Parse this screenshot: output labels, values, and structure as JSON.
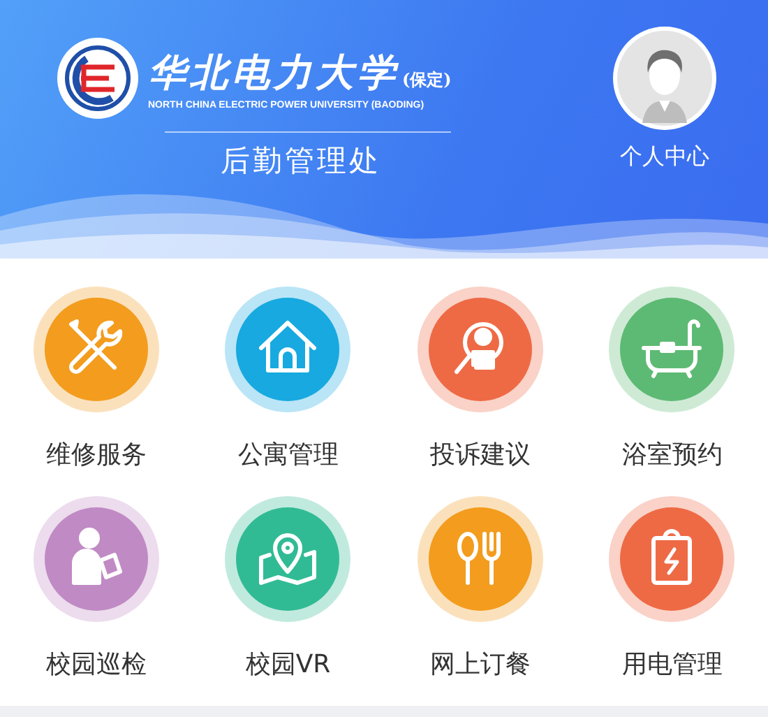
{
  "header": {
    "university_name": "华北电力大学",
    "campus": "(保定)",
    "english_name": "NORTH CHINA ELECTRIC POWER UNIVERSITY (BAODING)",
    "department": "后勤管理处",
    "profile_label": "个人中心"
  },
  "items": [
    {
      "label": "维修服务",
      "kind": "repair",
      "color": "#f39c1e"
    },
    {
      "label": "公寓管理",
      "kind": "house",
      "color": "#17a9e0"
    },
    {
      "label": "投诉建议",
      "kind": "complaint",
      "color": "#ee6a45"
    },
    {
      "label": "浴室预约",
      "kind": "bath",
      "color": "#5dba74"
    },
    {
      "label": "校园巡检",
      "kind": "inspect",
      "color": "#c08ac4"
    },
    {
      "label": "校园VR",
      "kind": "map",
      "color": "#31bb95"
    },
    {
      "label": "网上订餐",
      "kind": "food",
      "color": "#f39c1e"
    },
    {
      "label": "用电管理",
      "kind": "power",
      "color": "#ee6a45"
    }
  ]
}
